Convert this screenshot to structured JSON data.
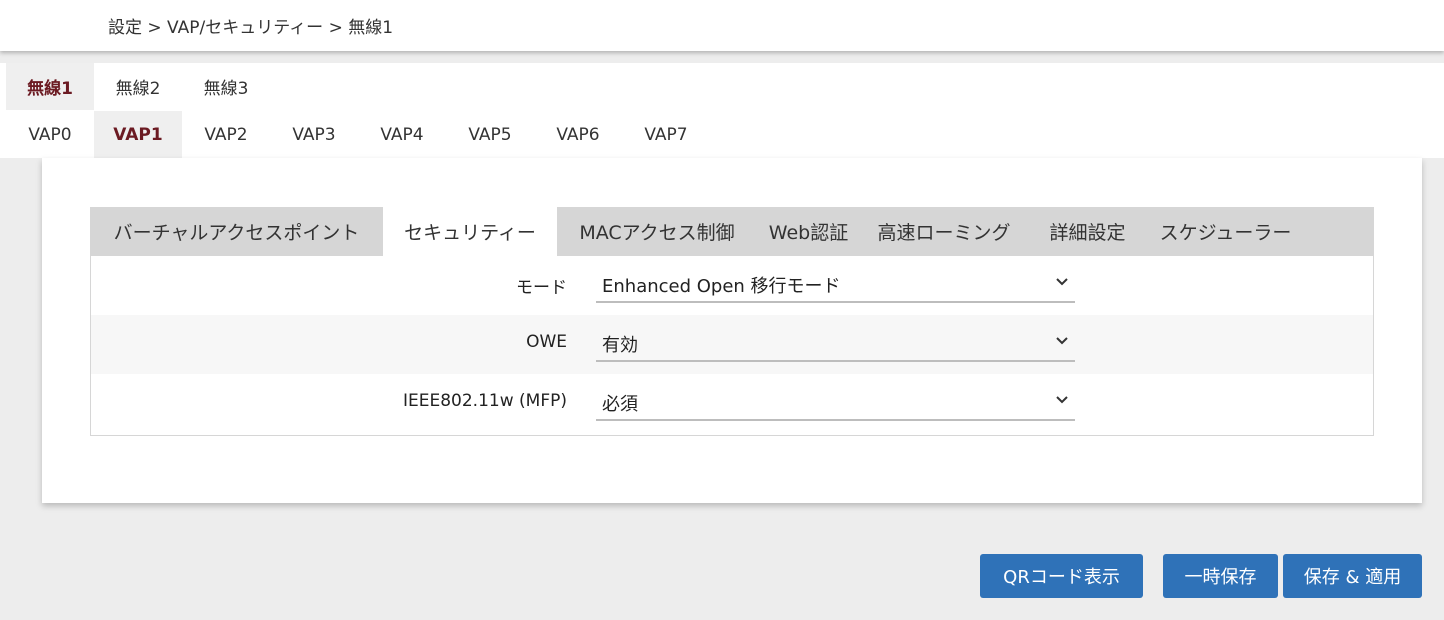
{
  "breadcrumb": "設定 > VAP/セキュリティー > 無線1",
  "radio_tabs": [
    "無線1",
    "無線2",
    "無線3"
  ],
  "vap_tabs": [
    "VAP0",
    "VAP1",
    "VAP2",
    "VAP3",
    "VAP4",
    "VAP5",
    "VAP6",
    "VAP7"
  ],
  "sub_tabs": [
    "バーチャルアクセスポイント",
    "セキュリティー",
    "MACアクセス制御",
    "Web認証",
    "高速ローミング",
    "詳細設定",
    "スケジューラー"
  ],
  "form": {
    "mode_label": "モード",
    "mode_value": "Enhanced Open 移行モード",
    "owe_label": "OWE",
    "owe_value": "有効",
    "mfp_label": "IEEE802.11w (MFP)",
    "mfp_value": "必須"
  },
  "buttons": {
    "qr": "QRコード表示",
    "temp_save": "一時保存",
    "save_apply": "保存 & 適用"
  },
  "colors": {
    "accent": "#6b1a22",
    "button": "#2f72b8",
    "subtab_bg": "#d6d6d6"
  }
}
